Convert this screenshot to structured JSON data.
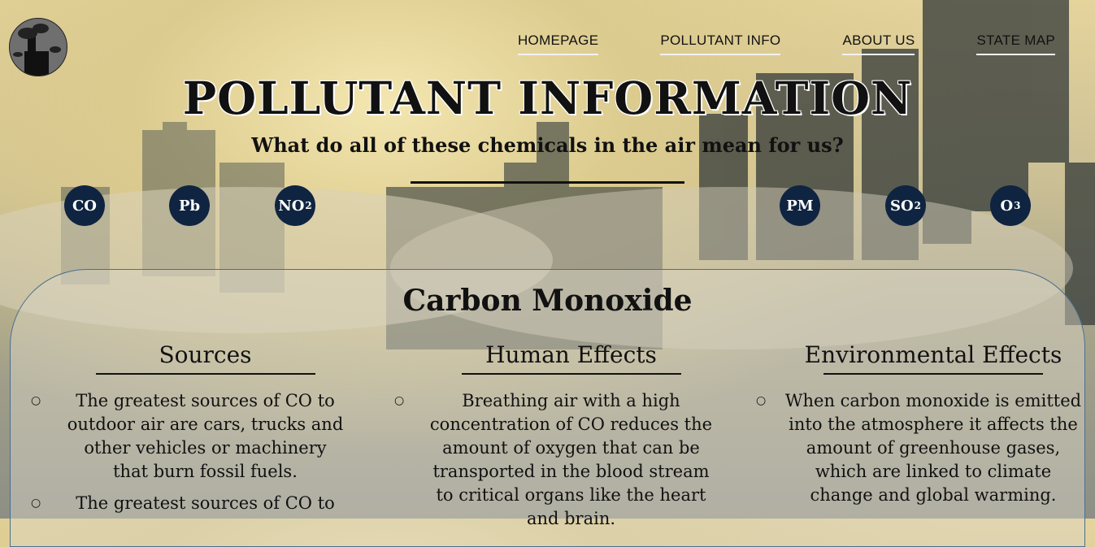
{
  "nav": {
    "items": [
      {
        "label": "HOMEPAGE"
      },
      {
        "label": "POLLUTANT INFO"
      },
      {
        "label": "ABOUT US"
      },
      {
        "label": "STATE MAP"
      }
    ]
  },
  "header": {
    "title": "POLLUTANT INFORMATION",
    "subtitle": "What do all of these chemicals in the air mean for us?"
  },
  "pollutants": [
    {
      "label": "CO",
      "sub": ""
    },
    {
      "label": "Pb",
      "sub": ""
    },
    {
      "label": "NO",
      "sub": "2"
    },
    {
      "label": "PM",
      "sub": ""
    },
    {
      "label": "SO",
      "sub": "2"
    },
    {
      "label": "O",
      "sub": "3"
    }
  ],
  "panel": {
    "title": "Carbon Monoxide",
    "columns": [
      {
        "heading": "Sources",
        "items": [
          "The greatest sources of CO to outdoor air are cars, trucks and other vehicles or machinery that burn fossil fuels.",
          "The greatest sources of CO to"
        ]
      },
      {
        "heading": "Human Effects",
        "items": [
          "Breathing air with a high concentration of CO reduces the amount of oxygen that can be transported in the blood stream to critical organs like the heart and brain."
        ]
      },
      {
        "heading": "Environmental Effects",
        "items": [
          "When carbon monoxide is emitted into the atmosphere it affects the amount of greenhouse gases, which are linked to climate change and global warming."
        ]
      }
    ]
  },
  "icons": {
    "logo": "factory-smoke-logo-icon",
    "bullet": "hollow-circle-bullet-icon"
  },
  "colors": {
    "chip_bg": "#0f2440",
    "panel_border": "#4a6f8f"
  }
}
